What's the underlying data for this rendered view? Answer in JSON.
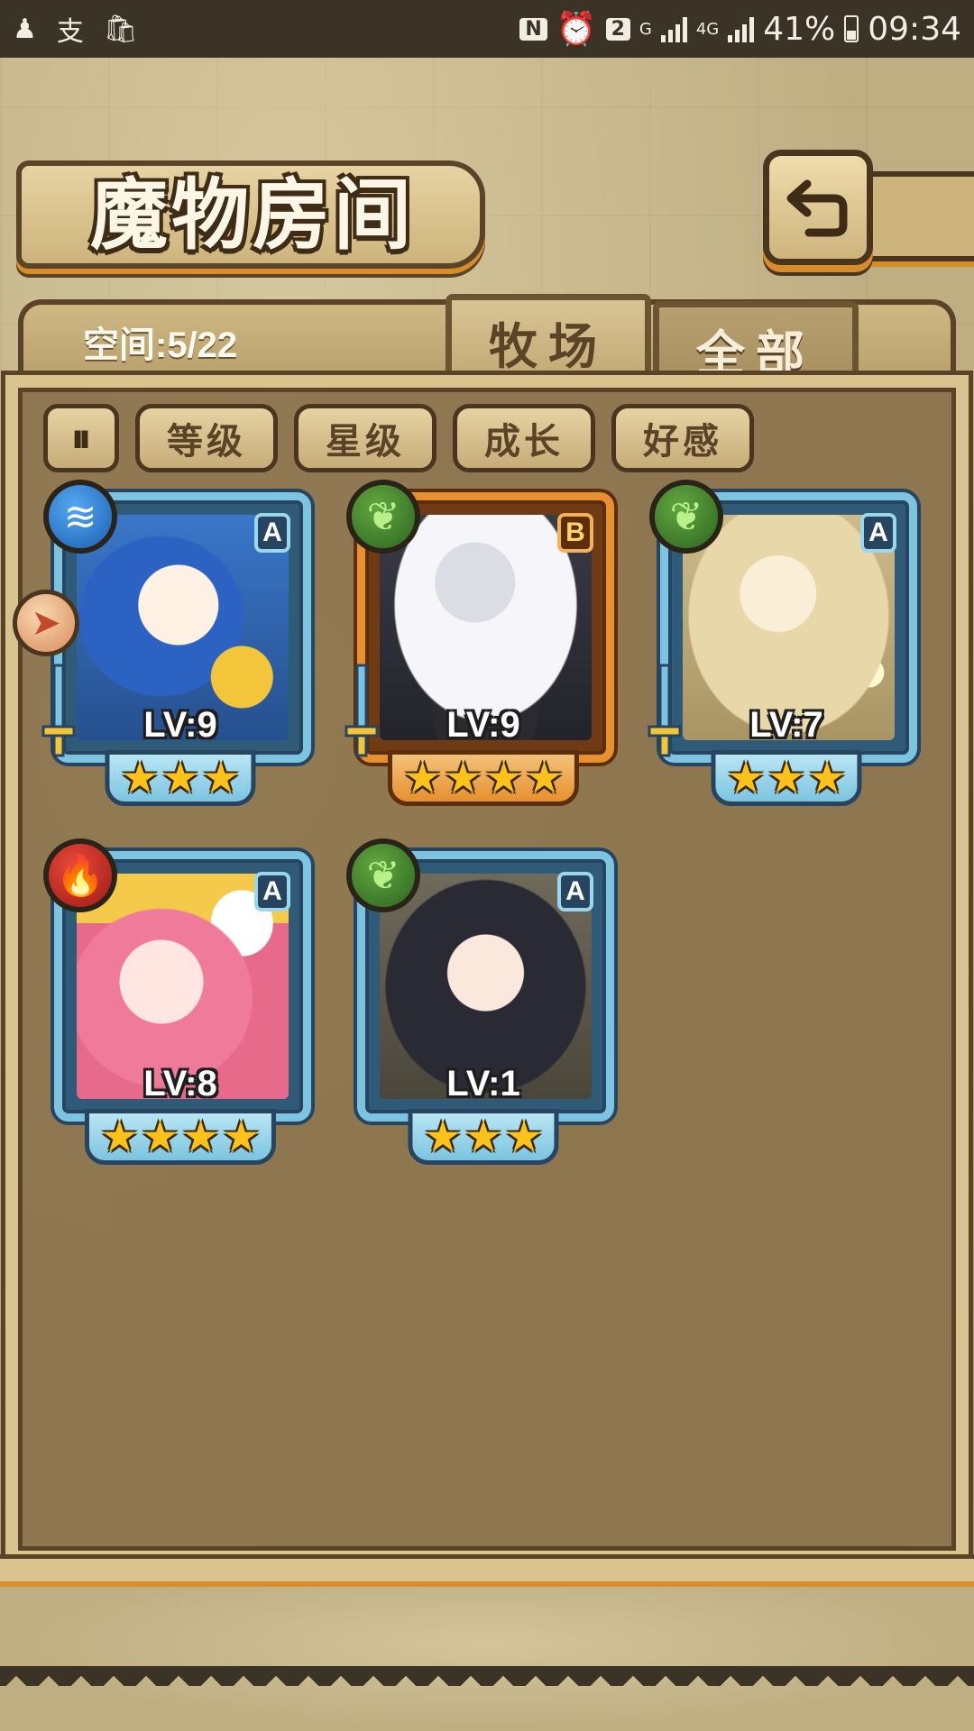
{
  "status_bar": {
    "left_icons": [
      "person-icon",
      "alipay-icon",
      "shopping-bag-icon"
    ],
    "nfc_icon": "N",
    "notification_count": "2",
    "network_small": "G",
    "network_type": "4G",
    "battery_percent": "41%",
    "time": "09:34"
  },
  "header": {
    "title": "魔物房间",
    "back_icon": "return-arrow-icon"
  },
  "panel": {
    "space_label": "空间:5/22",
    "tabs": [
      {
        "label": "牧场",
        "active": true
      },
      {
        "label": "全部",
        "active": false
      }
    ],
    "filter_toggle_label": "⏸",
    "filters": [
      "等级",
      "星级",
      "成长",
      "好感"
    ]
  },
  "monsters": [
    {
      "rank": "A",
      "element": "water",
      "element_icon": "water-element-icon",
      "level": "LV:9",
      "stars": 3,
      "frame": "blue",
      "weapon": true
    },
    {
      "rank": "B",
      "element": "wood",
      "element_icon": "wood-element-icon",
      "level": "LV:9",
      "stars": 4,
      "frame": "orange",
      "weapon": true
    },
    {
      "rank": "A",
      "element": "wood",
      "element_icon": "wood-element-icon",
      "level": "LV:7",
      "stars": 3,
      "frame": "blue",
      "weapon": true
    },
    {
      "rank": "A",
      "element": "fire",
      "element_icon": "fire-element-icon",
      "level": "LV:8",
      "stars": 4,
      "frame": "blue",
      "weapon": false
    },
    {
      "rank": "A",
      "element": "wood",
      "element_icon": "wood-element-icon",
      "level": "LV:1",
      "stars": 3,
      "frame": "blue",
      "weapon": false
    }
  ],
  "colors": {
    "frame_blue": "#7cc4e0",
    "frame_orange": "#e7902e",
    "star": "#ffc21a",
    "panel": "#8d7650"
  }
}
